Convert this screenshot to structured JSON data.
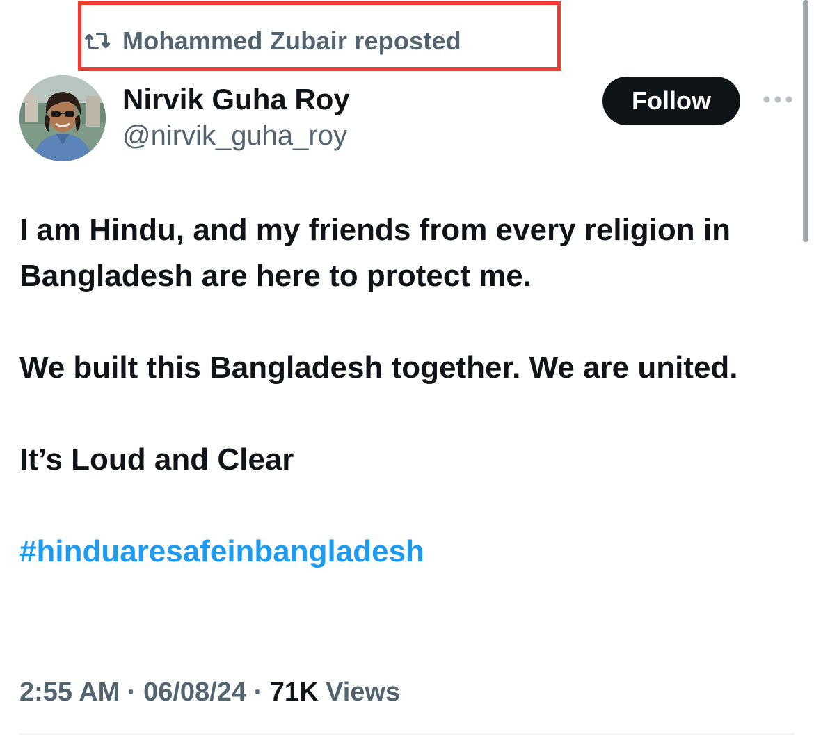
{
  "repost": {
    "label": "Mohammed Zubair reposted",
    "icon": "repost-icon"
  },
  "author": {
    "name": "Nirvik Guha Roy",
    "handle": "@nirvik_guha_roy"
  },
  "actions": {
    "follow_label": "Follow",
    "more_icon": "more-horizontal-icon"
  },
  "post": {
    "paragraphs": [
      "I am Hindu, and my friends from every religion in Bangladesh are here to protect me.",
      "We built this Bangladesh together. We are united.",
      "It’s Loud and Clear"
    ],
    "hashtag": "#hinduaresafeinbangladesh"
  },
  "meta": {
    "time": "2:55 AM",
    "separator": "·",
    "date": "06/08/24",
    "views_count": "71K",
    "views_label": "Views"
  },
  "colors": {
    "highlight_border": "#f23a30",
    "hashtag": "#1d9bf0",
    "secondary_text": "#536471",
    "primary_text": "#0f1419",
    "follow_bg": "#0f1419"
  }
}
